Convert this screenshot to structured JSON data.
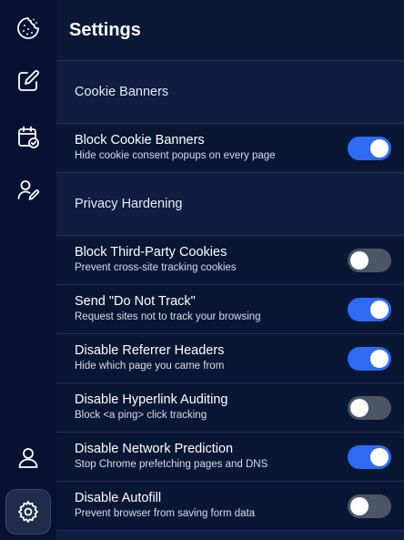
{
  "header": {
    "title": "Settings"
  },
  "sidebar": {
    "items": [
      {
        "icon": "cookie-icon"
      },
      {
        "icon": "edit-icon"
      },
      {
        "icon": "calendar-check-icon"
      },
      {
        "icon": "user-edit-icon"
      },
      {
        "icon": "user-icon"
      },
      {
        "icon": "gear-icon",
        "active": true
      }
    ]
  },
  "sections": {
    "cookie_banners": {
      "label": "Cookie Banners",
      "items": [
        {
          "title": "Block Cookie Banners",
          "desc": "Hide cookie consent popups on every page",
          "enabled": true
        }
      ]
    },
    "privacy_hardening": {
      "label": "Privacy Hardening",
      "items": [
        {
          "title": "Block Third-Party Cookies",
          "desc": "Prevent cross-site tracking cookies",
          "enabled": false
        },
        {
          "title": "Send \"Do Not Track\"",
          "desc": "Request sites not to track your browsing",
          "enabled": true
        },
        {
          "title": "Disable Referrer Headers",
          "desc": "Hide which page you came from",
          "enabled": true
        },
        {
          "title": "Disable Hyperlink Auditing",
          "desc": "Block <a ping> click tracking",
          "enabled": false
        },
        {
          "title": "Disable Network Prediction",
          "desc": "Stop Chrome prefetching pages and DNS",
          "enabled": true
        },
        {
          "title": "Disable Autofill",
          "desc": "Prevent browser from saving form data",
          "enabled": false
        }
      ]
    }
  },
  "colors": {
    "toggle_on": "#2f6bf3",
    "toggle_off": "#4e5666",
    "background": "#0e1d40",
    "sidebar": "#071232"
  }
}
